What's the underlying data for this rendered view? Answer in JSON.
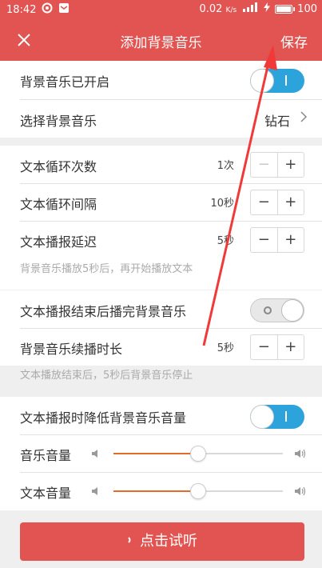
{
  "status": {
    "time": "18:42",
    "net_speed": "0.02",
    "net_unit": "K/s",
    "battery": "100"
  },
  "appbar": {
    "close_icon": "close-icon",
    "title": "添加背景音乐",
    "save_label": "保存"
  },
  "section1": {
    "bg_music_label": "背景音乐已开启",
    "bg_music_enabled": true,
    "select_label": "选择背景音乐",
    "select_value": "钻石"
  },
  "section2": {
    "loop_label": "文本循环次数",
    "loop_value": "1次",
    "interval_label": "文本循环间隔",
    "interval_value": "10秒",
    "delay_label": "文本播报延迟",
    "delay_value": "5秒",
    "hint": "背景音乐播放5秒后，再开始播放文本"
  },
  "section3": {
    "finish_label": "文本播报结束后播完背景音乐",
    "finish_enabled": false,
    "continue_label": "背景音乐续播时长",
    "continue_value": "5秒",
    "hint": "文本播放结束后，5秒后背景音乐停止"
  },
  "section4": {
    "duck_label": "文本播报时降低背景音乐音量",
    "duck_enabled": true,
    "music_volume_label": "音乐音量",
    "music_volume": 0.5,
    "text_volume_label": "文本音量",
    "text_volume": 0.5
  },
  "footer": {
    "listen_label": "点击试听"
  },
  "stepper": {
    "minus": "−",
    "plus": "+"
  },
  "colors": {
    "accent": "#e25451",
    "toggle_on": "#2da3dc",
    "slider_fill": "#e66a2a",
    "annotation_arrow": "#f03a3a"
  }
}
